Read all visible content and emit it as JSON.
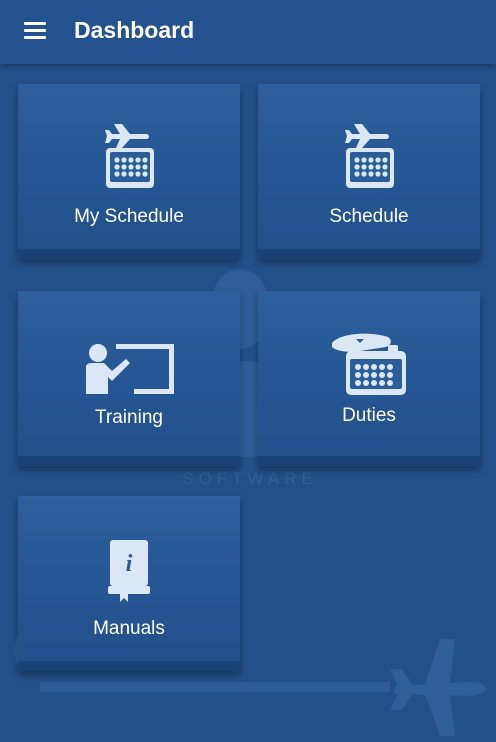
{
  "header": {
    "title": "Dashboard",
    "menu_icon": "hamburger-menu-icon"
  },
  "background": {
    "logo_text": "SOFTWARE"
  },
  "tiles": [
    {
      "label": "My Schedule",
      "icon": "calendar-flight-icon"
    },
    {
      "label": "Schedule",
      "icon": "calendar-flight-icon"
    },
    {
      "label": "Training",
      "icon": "instructor-whiteboard-icon"
    },
    {
      "label": "Duties",
      "icon": "pilot-cap-calendar-icon"
    },
    {
      "label": "Manuals",
      "icon": "info-manual-icon"
    }
  ],
  "colors": {
    "background": "#24508a",
    "appbar": "#23528f",
    "tile": "#2c5f9c",
    "icon": "#dbe7f6"
  }
}
